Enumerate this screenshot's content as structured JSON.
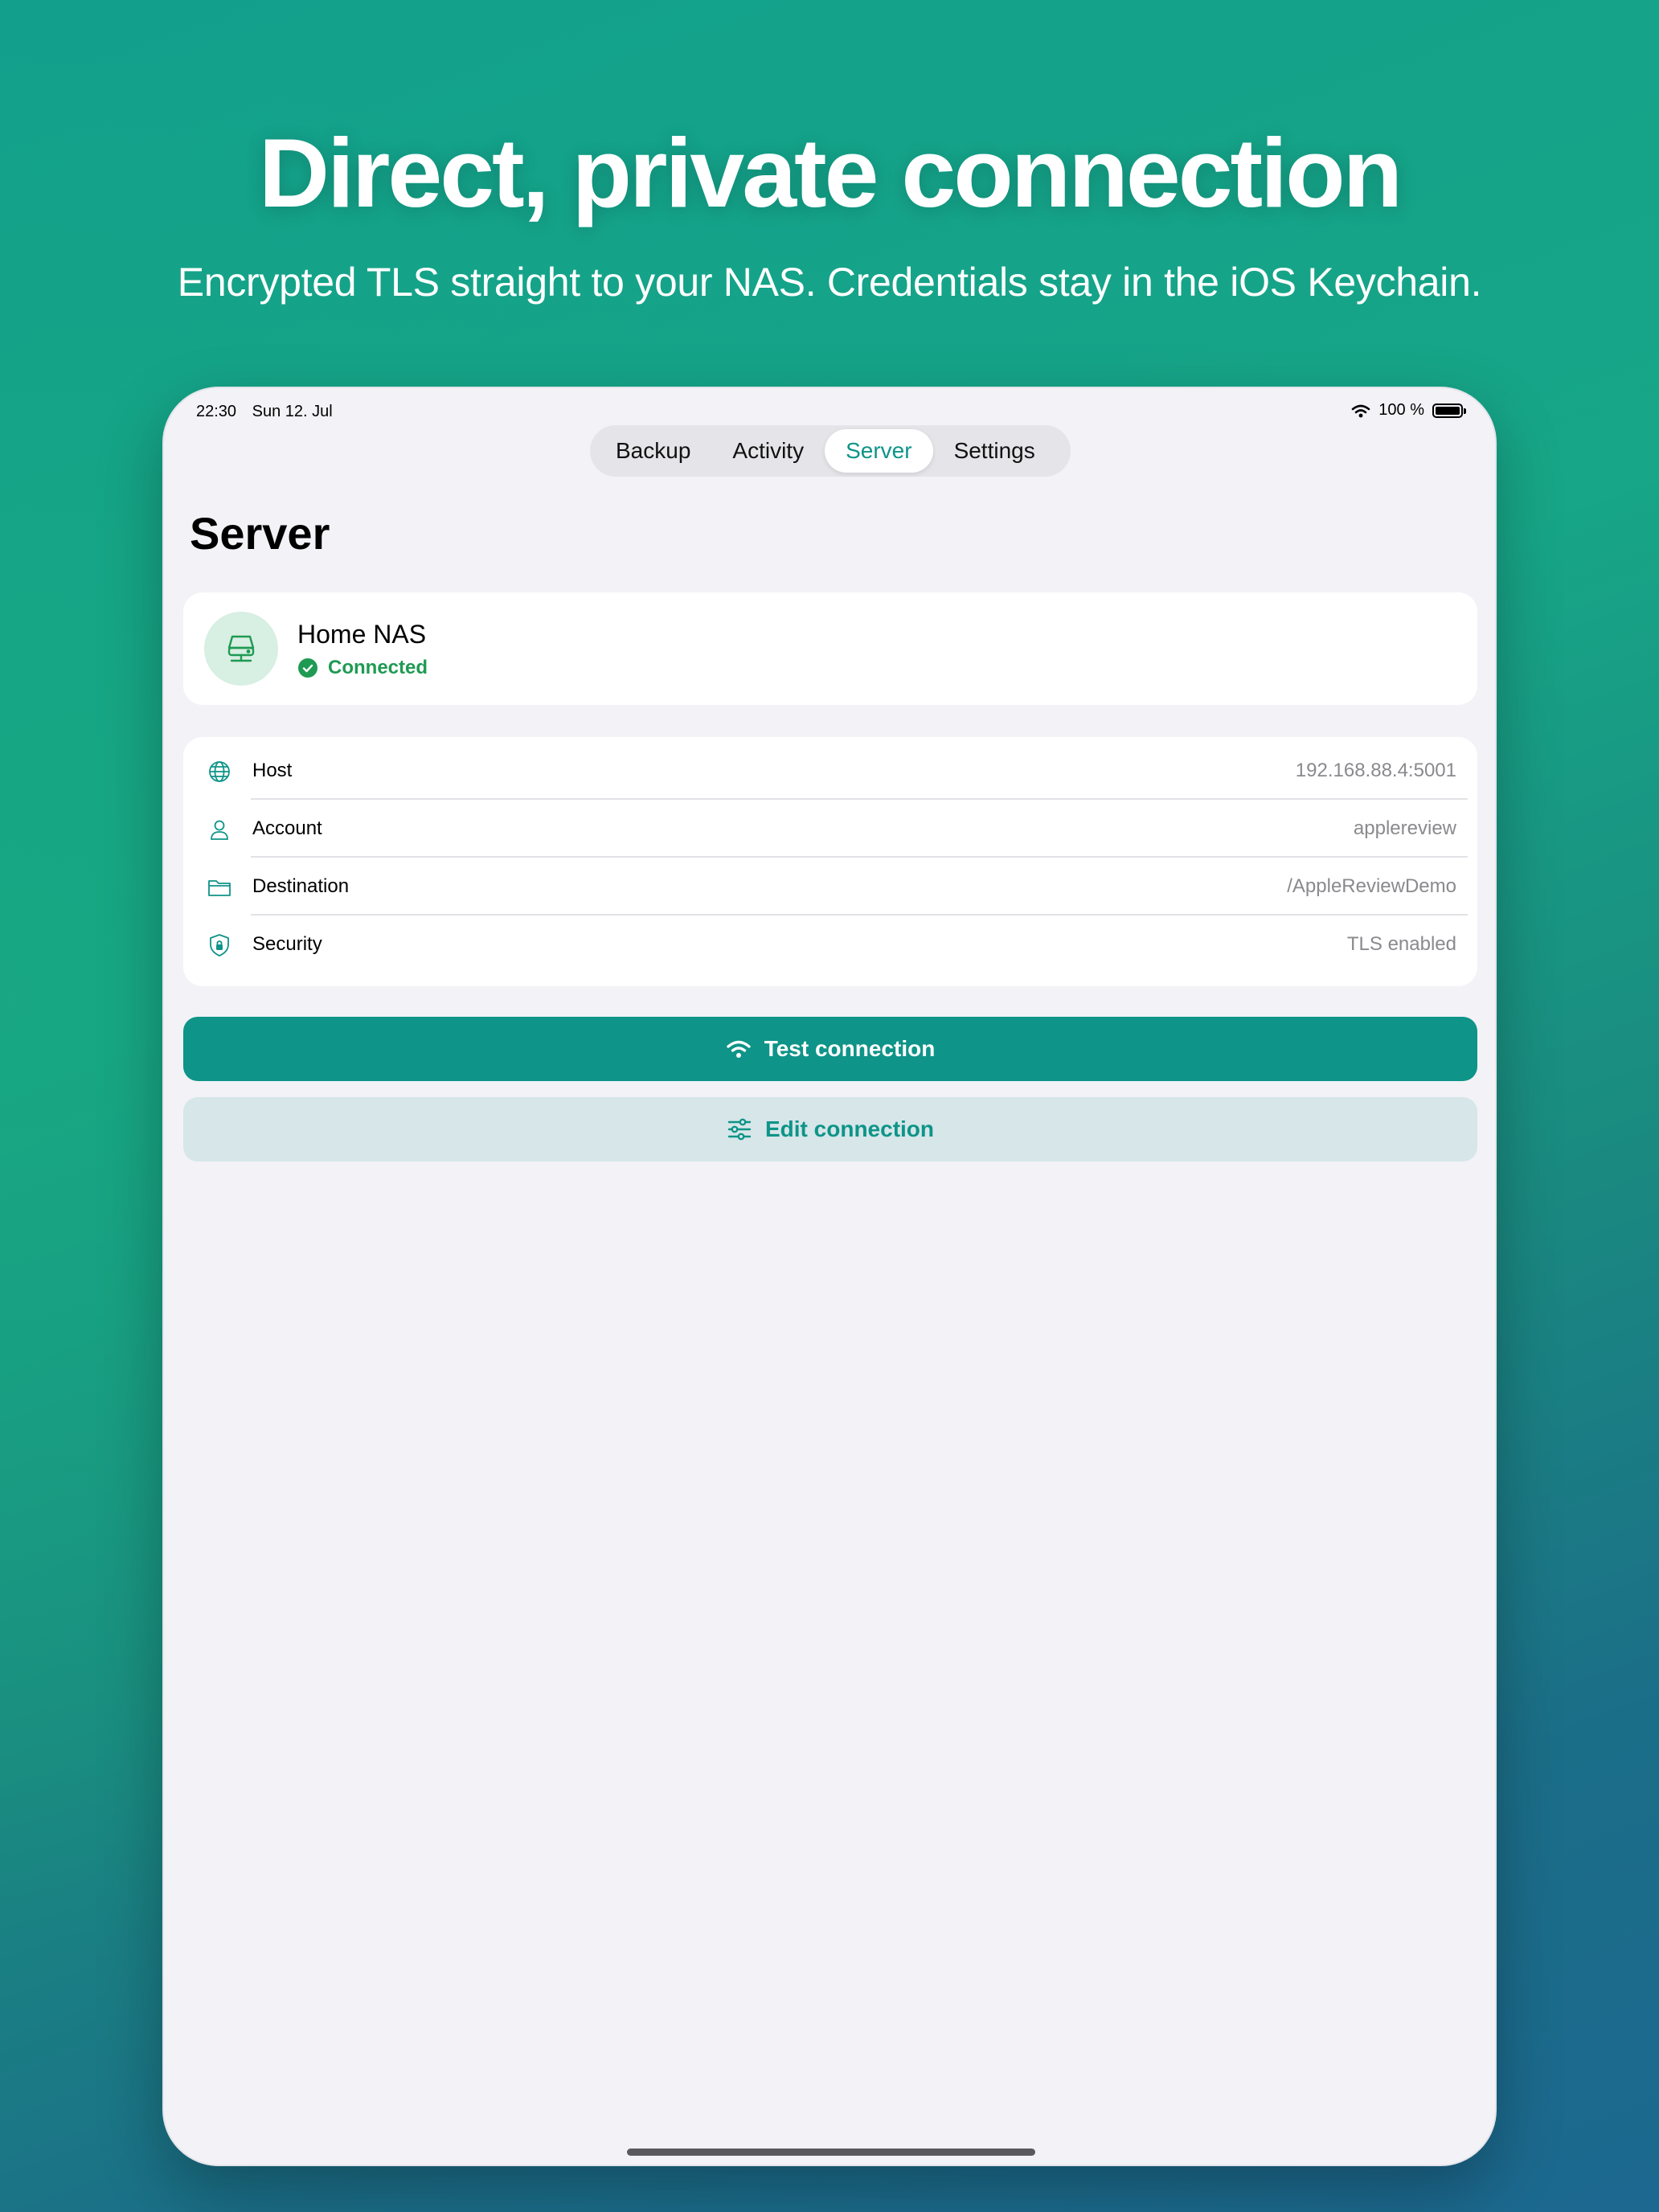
{
  "hero": {
    "title": "Direct, private connection",
    "subtitle": "Encrypted TLS straight to your NAS. Credentials stay in the iOS Keychain."
  },
  "statusbar": {
    "time": "22:30",
    "date": "Sun 12. Jul",
    "battery": "100 %"
  },
  "tabs": [
    {
      "label": "Backup"
    },
    {
      "label": "Activity"
    },
    {
      "label": "Server",
      "active": true
    },
    {
      "label": "Settings"
    }
  ],
  "page": {
    "title": "Server"
  },
  "server": {
    "name": "Home NAS",
    "status": "Connected",
    "icon": "nas-drive-icon"
  },
  "details": [
    {
      "icon": "globe-icon",
      "label": "Host",
      "value": "192.168.88.4:5001"
    },
    {
      "icon": "person-icon",
      "label": "Account",
      "value": "applereview"
    },
    {
      "icon": "folder-icon",
      "label": "Destination",
      "value": "/AppleReviewDemo"
    },
    {
      "icon": "shield-lock-icon",
      "label": "Security",
      "value": "TLS enabled"
    }
  ],
  "buttons": {
    "test": {
      "label": "Test connection",
      "icon": "wifi-icon"
    },
    "edit": {
      "label": "Edit connection",
      "icon": "sliders-icon"
    }
  },
  "colors": {
    "accent": "#0e9488",
    "success": "#1f9a53",
    "secondary_button": "#d6e6e9",
    "background": "#f2f2f7"
  }
}
